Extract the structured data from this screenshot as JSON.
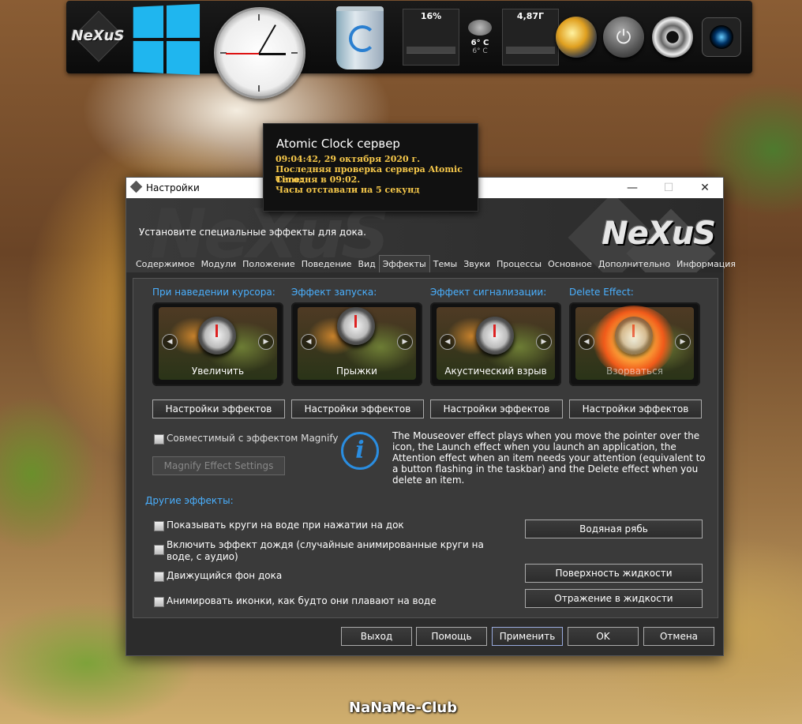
{
  "dock": {
    "nexus_logo": "NeXuS",
    "cpu_meter": "16%",
    "weather_temp": "6° C",
    "weather_sub": "6° C",
    "ram_meter": "4,87Г"
  },
  "tooltip": {
    "title": "Atomic Clock сервер",
    "line1": "09:04:42, 29 октября 2020 г.",
    "line2": "Последняя проверка сервера Atomic Time:",
    "line3": "Сегодня в 09:02.",
    "line4": "Часы отставали на 5 секунд"
  },
  "window": {
    "title": "Настройки",
    "minimize": "—",
    "maximize": "☐",
    "close": "✕",
    "banner_watermark": "NeXuS",
    "banner_heading": "Установите специальные эффекты для дока.",
    "banner_logo": "NeXuS"
  },
  "tabs": [
    "Содержимое",
    "Модули",
    "Положение",
    "Поведение",
    "Вид",
    "Эффекты",
    "Темы",
    "Звуки",
    "Процессы",
    "Основное",
    "Дополнительно",
    "Информация"
  ],
  "active_tab": "Эффекты",
  "effects": [
    {
      "label": "При наведении курсора:",
      "name": "Увеличить",
      "button": "Настройки эффектов"
    },
    {
      "label": "Эффект запуска:",
      "name": "Прыжки",
      "button": "Настройки эффектов"
    },
    {
      "label": "Эффект сигнализации:",
      "name": "Акустический взрыв",
      "button": "Настройки эффектов"
    },
    {
      "label": "Delete Effect:",
      "name": "Взорваться",
      "button": "Настройки эффектов"
    }
  ],
  "magnify": {
    "checkbox_label": "Совместимый с эффектом Magnify",
    "button": "Magnify Effect Settings"
  },
  "info_text": "The Mouseover effect plays when you move the pointer over the icon, the Launch effect when you launch an application, the Attention effect when an item needs your attention (equivalent to a button flashing in the taskbar) and the Delete effect when you delete an item.",
  "other": {
    "heading": "Другие эффекты:",
    "opt1": "Показывать круги на воде при нажатии на док",
    "opt2": "Включить эффект дождя (случайные анимированные круги на воде, с аудио)",
    "opt3": "Движущийся фон дока",
    "opt4": "Анимировать иконки, как будто они плавают на воде",
    "btn_ripple": "Водяная рябь",
    "btn_surface": "Поверхность жидкости",
    "btn_reflection": "Отражение в жидкости"
  },
  "footer": {
    "exit": "Выход",
    "help": "Помощь",
    "apply": "Применить",
    "ok": "OK",
    "cancel": "Отмена"
  },
  "watermark": "NaNaMe-Club",
  "colors": {
    "accent": "#4ab0ff",
    "tooltip_text": "#f6c84a",
    "windows_blue": "#1fb6ef"
  }
}
